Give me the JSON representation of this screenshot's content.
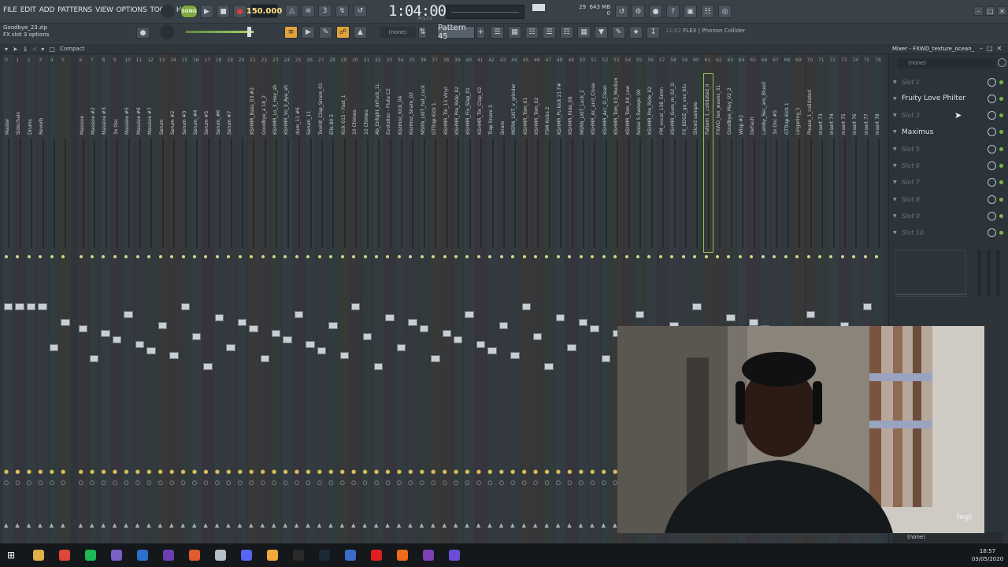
{
  "menu": [
    "FILE",
    "EDIT",
    "ADD",
    "PATTERNS",
    "VIEW",
    "OPTIONS",
    "TOOLS",
    "HELP"
  ],
  "song_mode": "SONG",
  "tempo": "150.000",
  "time": "1:04:00",
  "time_unit": "M:S:CS",
  "memory": {
    "cpu": "29",
    "mem": "643 MB",
    "poly": "0"
  },
  "hint": {
    "line1": "Goodbye_23.zip",
    "line2": "FX slot 3 options"
  },
  "pattern": "Pattern 45",
  "none_label": "(none)",
  "plugin_status": {
    "index": "11/02",
    "name": "FLEX | Phonon Collider"
  },
  "compact_label": "Compact",
  "mixer_title": "Mixer - FXWD_texture_ocean_",
  "rack_search": "(none)",
  "rack_footer": "(none)",
  "slots": [
    {
      "label": "Slot 1",
      "active": false
    },
    {
      "label": "Fruity Love Philter",
      "active": true
    },
    {
      "label": "Slot 3",
      "active": false
    },
    {
      "label": "Maximus",
      "active": true
    },
    {
      "label": "Slot 5",
      "active": false
    },
    {
      "label": "Slot 6",
      "active": false
    },
    {
      "label": "Slot 7",
      "active": false
    },
    {
      "label": "Slot 8",
      "active": false
    },
    {
      "label": "Slot 9",
      "active": false
    },
    {
      "label": "Slot 10",
      "active": false
    }
  ],
  "channels": [
    "Master",
    "Sidechain",
    "Drums",
    "Reverb",
    "",
    "",
    "Massive",
    "Massive #2",
    "Massive #3",
    "3x Osc",
    "Massive #5",
    "Massive #6",
    "Massive #7",
    "Serum",
    "Serum #2",
    "Serum #3",
    "Serum_#4",
    "Serum #5",
    "Serum_#6",
    "Serum #7",
    "",
    "KSHMR_Bass_03 #2",
    "Goodbye_a 18_2",
    "KSHMR_Lo_3_Hey_ah",
    "KSHMR_Vo_3_Aye_ah",
    "dum_11 #6",
    "Serum_11",
    "TooHit_Clap_Snare_01",
    "Elle 80 5",
    "Kick 015 - Fast_1",
    "10 Chimes",
    "10 Chimes",
    "Ab_Enlight_drFuck_1L",
    "Evolution - Flute C2",
    "Kozmoz_Kick_04",
    "Kozmoz_Snare_02",
    "MSRN_LKIT_hat_cuck",
    "GTTrap Kick 1",
    "KSHMR_Tin_13 Vinyl",
    "KSHMR_Pre_Ride_02",
    "KSHMR_Flo_Slap_01",
    "KSHMR_Tin_Clap_02",
    "Trap Snare 3",
    "Snare",
    "MSRN_LKIT_v_grinder",
    "KSHMR_Tom_01",
    "KSHMR_Tom_02",
    "FSM Kicks 2",
    "KSHMR_Pu kick 21 F#",
    "KSHMR_Ride_08",
    "MSRN_LKIT_Luck_2",
    "KSHMR_Ac_and_Close",
    "KSHMR_Acc_O_Clean",
    "KSHMR_Tom_03_Medium",
    "KSHMR_Tom_04_Low",
    "Noise 5 Sweeps (9)",
    "KSHMR_Pre_Ride_02",
    "FM_vocal_138_Emin",
    "KSHMR_Gum_m_02_D",
    "FX_BDGE_go_vox_blu",
    "Sliced sample",
    "Pattern 1_colidated_II",
    "FXWD_tex_waves_31",
    "Goodbye_May_02_2",
    "Wisp #2",
    "DeFault",
    "Lamby_Rec_are_Blued",
    "3x Osc #5",
    "GTTrap Kick 1",
    "Lingering_1",
    "Please_1_colidated",
    "Insert 73",
    "Insert 74",
    "Insert 75",
    "Insert 76",
    "Insert 77",
    "Insert 78"
  ],
  "colors": {
    "bg": "#2e353b",
    "accent": "#7ea843",
    "tempo": "#ffe08a",
    "rec": "#e33a3a"
  },
  "taskbar_icons": [
    "windows-icon",
    "search-icon",
    "chrome-icon",
    "spotify-icon",
    "after-effects-icon",
    "photoshop-icon",
    "premiere-icon",
    "mail-icon",
    "settings-icon",
    "discord-icon",
    "fl-studio-icon",
    "live-icon",
    "steam-icon",
    "maps-icon",
    "acrobat-icon",
    "origin-icon",
    "obs-icon",
    "app-icon"
  ],
  "clock": {
    "time": "18:57",
    "date": "03/05/2020"
  },
  "webcam_brand": "logi"
}
